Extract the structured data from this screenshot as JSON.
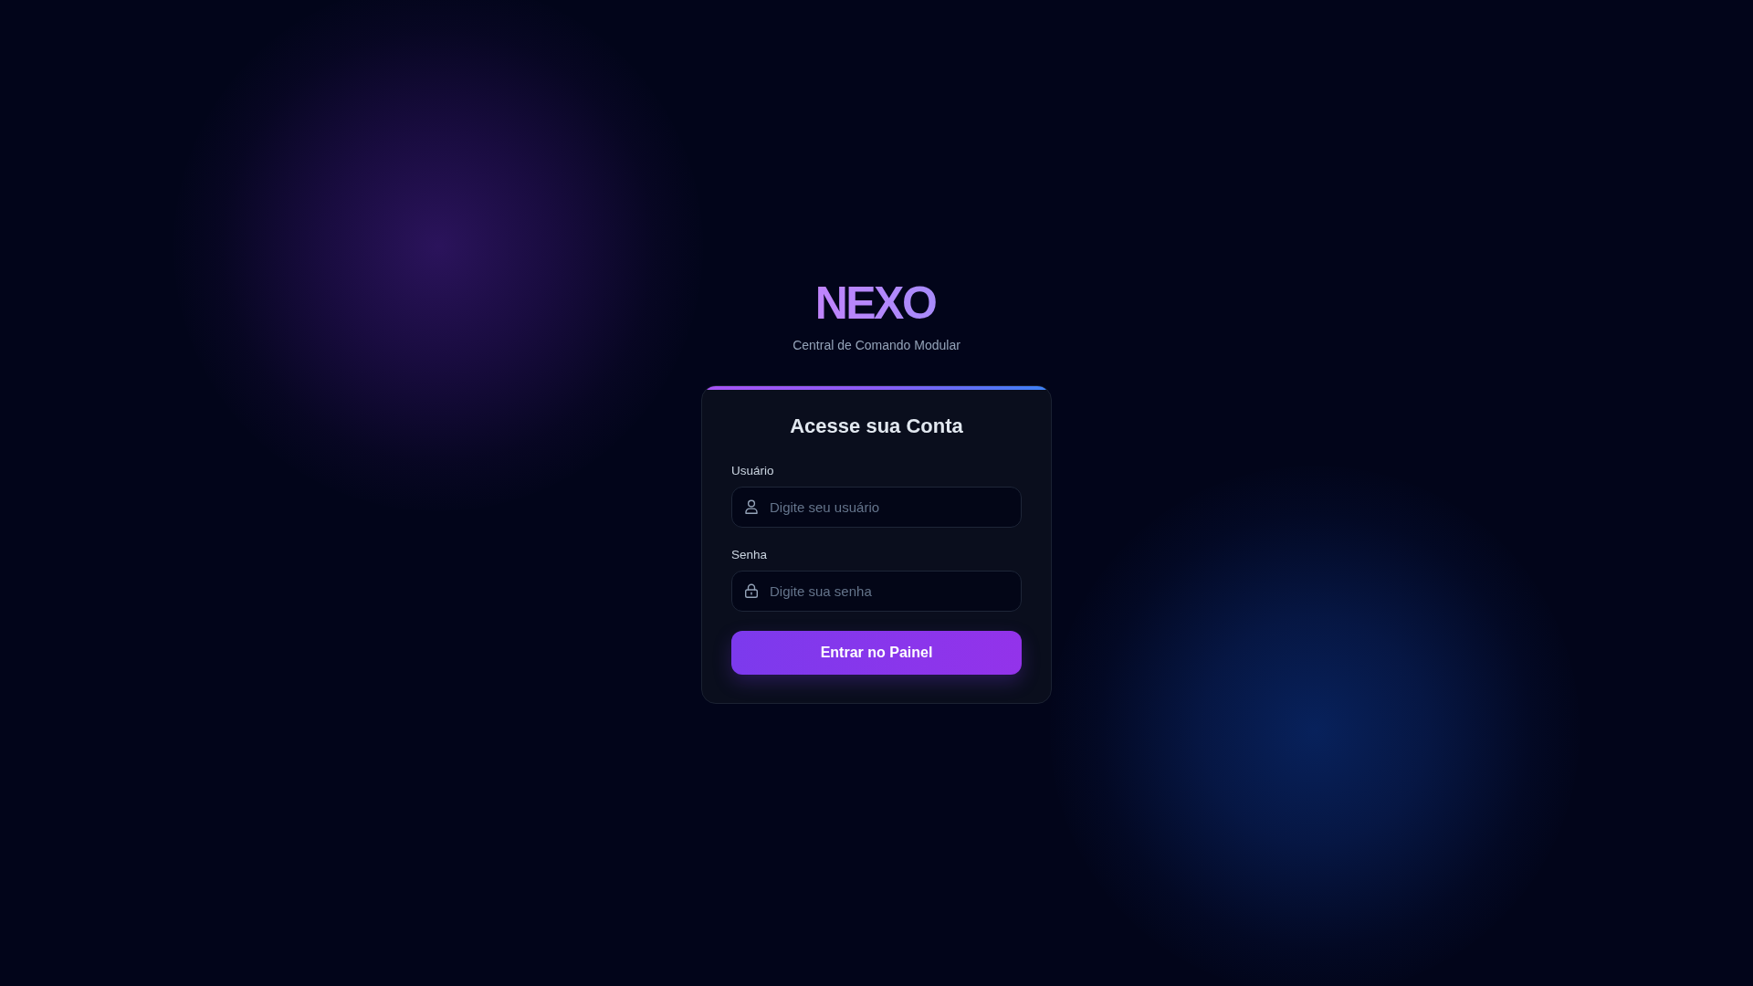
{
  "brand": {
    "logo": "NEXO",
    "tagline": "Central de Comando Modular"
  },
  "login_card": {
    "title": "Acesse sua Conta",
    "fields": [
      {
        "kind": "user",
        "label": "Usuário",
        "placeholder": "Digite seu usuário"
      },
      {
        "kind": "password",
        "label": "Senha",
        "placeholder": "Digite sua senha"
      }
    ],
    "submit_button": "Entrar no Painel"
  }
}
